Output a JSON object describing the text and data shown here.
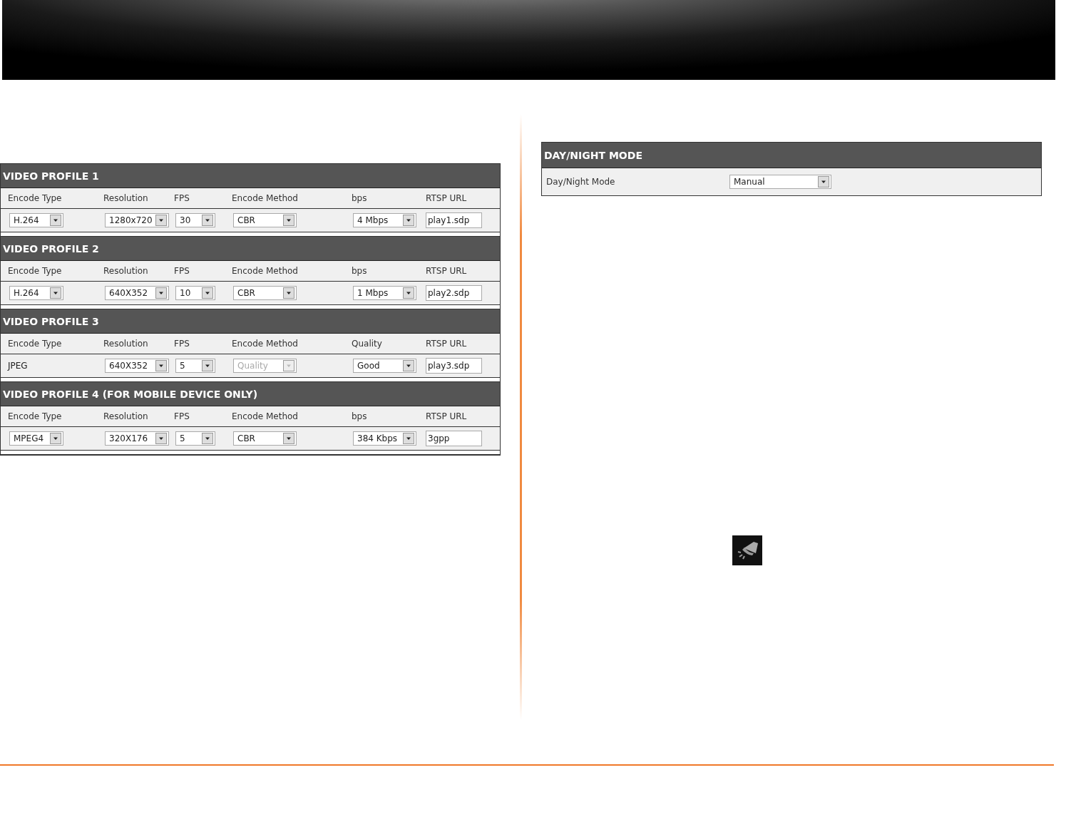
{
  "profiles": [
    {
      "title": "VIDEO PROFILE 1",
      "columns": [
        "Encode Type",
        "Resolution",
        "FPS",
        "Encode Method",
        "bps",
        "RTSP URL"
      ],
      "fields": [
        {
          "kind": "select",
          "value": "H.264",
          "disabled": false
        },
        {
          "kind": "select",
          "value": "1280x720",
          "disabled": false
        },
        {
          "kind": "select",
          "value": "30",
          "disabled": false
        },
        {
          "kind": "select",
          "value": "CBR",
          "disabled": false
        },
        {
          "kind": "select",
          "value": "4 Mbps",
          "disabled": false
        },
        {
          "kind": "input",
          "value": "play1.sdp"
        }
      ]
    },
    {
      "title": "VIDEO PROFILE 2",
      "columns": [
        "Encode Type",
        "Resolution",
        "FPS",
        "Encode Method",
        "bps",
        "RTSP URL"
      ],
      "fields": [
        {
          "kind": "select",
          "value": "H.264",
          "disabled": false
        },
        {
          "kind": "select",
          "value": "640X352",
          "disabled": false
        },
        {
          "kind": "select",
          "value": "10",
          "disabled": false
        },
        {
          "kind": "select",
          "value": "CBR",
          "disabled": false
        },
        {
          "kind": "select",
          "value": "1 Mbps",
          "disabled": false
        },
        {
          "kind": "input",
          "value": "play2.sdp"
        }
      ]
    },
    {
      "title": "VIDEO PROFILE 3",
      "columns": [
        "Encode Type",
        "Resolution",
        "FPS",
        "Encode Method",
        "Quality",
        "RTSP URL"
      ],
      "fields": [
        {
          "kind": "text",
          "value": "JPEG"
        },
        {
          "kind": "select",
          "value": "640X352",
          "disabled": false
        },
        {
          "kind": "select",
          "value": "5",
          "disabled": false
        },
        {
          "kind": "select",
          "value": "Quality",
          "disabled": true
        },
        {
          "kind": "select",
          "value": "Good",
          "disabled": false
        },
        {
          "kind": "input",
          "value": "play3.sdp"
        }
      ]
    },
    {
      "title": "VIDEO PROFILE 4 (FOR MOBILE DEVICE ONLY)",
      "columns": [
        "Encode Type",
        "Resolution",
        "FPS",
        "Encode Method",
        "bps",
        "RTSP URL"
      ],
      "fields": [
        {
          "kind": "select",
          "value": "MPEG4",
          "disabled": false
        },
        {
          "kind": "select",
          "value": "320X176",
          "disabled": false
        },
        {
          "kind": "select",
          "value": "5",
          "disabled": false
        },
        {
          "kind": "select",
          "value": "CBR",
          "disabled": false
        },
        {
          "kind": "select",
          "value": "384 Kbps",
          "disabled": false
        },
        {
          "kind": "input",
          "value": "3gpp"
        }
      ]
    }
  ],
  "day_night": {
    "title": "DAY/NIGHT MODE",
    "label": "Day/Night Mode",
    "value": "Manual"
  }
}
